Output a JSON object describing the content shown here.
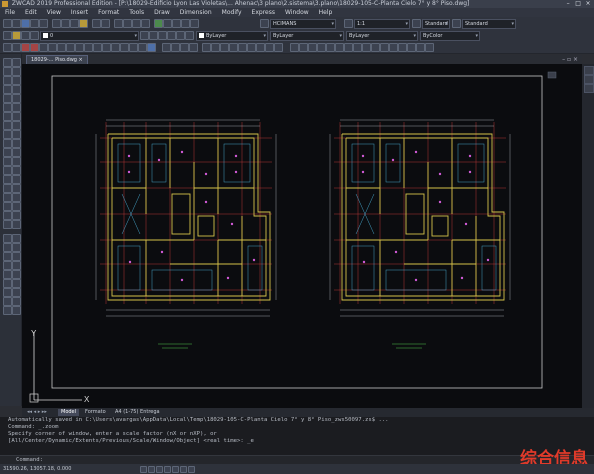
{
  "window": {
    "title": "ZWCAD 2019 Professional Edition - [P:\\18029-Edificio Lyon Las Violetas\\... Ahenac\\3 plano\\2.sistema\\3.plano\\18029-105-C-Planta Cielo 7° y 8° Piso.dwg]",
    "controls": [
      "–",
      "□",
      "×"
    ]
  },
  "menu": [
    "File",
    "Edit",
    "View",
    "Insert",
    "Format",
    "Tools",
    "Draw",
    "Dimension",
    "Modify",
    "Express",
    "Window",
    "Help"
  ],
  "toolbar": {
    "text_style": "HCIMANS",
    "scale": "1:1",
    "dim_style": "Standard",
    "table_style": "Standard",
    "layer": "0",
    "color": "ByLayer",
    "linetype": "ByLayer",
    "lineweight": "ByLayer",
    "plot_style": "ByColor"
  },
  "doc_tab": "18029-... Piso.dwg",
  "layout_tabs": [
    "Model",
    "Formato",
    "A4 (1-75) Entrega"
  ],
  "command_history": [
    "Automatically saved in C:\\Users\\avargas\\AppData\\Local\\Temp\\18029-105-C-Planta Cielo 7° y 8° Piso_zws50097.zs$ ...",
    "Command: _.zoom",
    "Specify corner of window, enter a scale factor (nX or nXP), or",
    "[All/Center/Dynamic/Extents/Previous/Scale/Window/Object] <real time>: _e"
  ],
  "command_prompt": "Command:",
  "status": {
    "coords": "31590.26, 13057.18, 0.000"
  },
  "watermark": "综合信息",
  "colors": {
    "canvas": "#0b0c0f",
    "accent": "#4e6fa8",
    "watermark": "#e03a2a",
    "plan_wall": "#d4c24a",
    "plan_grid": "#d23c3c",
    "plan_detail": "#4ab0d8"
  }
}
